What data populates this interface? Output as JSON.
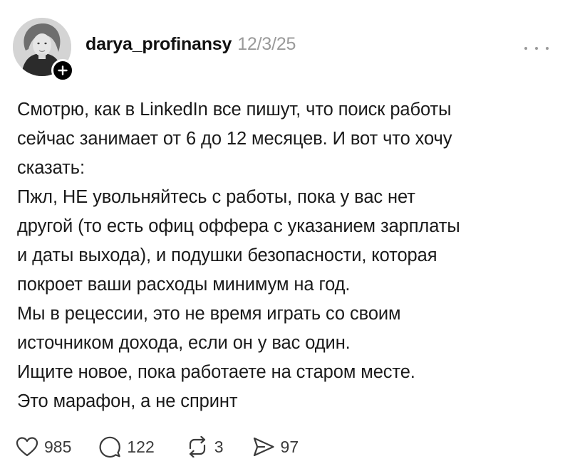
{
  "post": {
    "username": "darya_profinansy",
    "timestamp": "12/3/25",
    "more_icon": "more-dots-icon",
    "avatar_alt": "profile-photo",
    "follow_icon": "plus-icon",
    "lines": [
      "Смотрю, как в LinkedIn все пишут, что поиск работы",
      "сейчас занимает от 6 до 12 месяцев. И вот что хочу",
      "сказать:",
      "Пжл, НЕ увольняйтесь с работы, пока у вас нет",
      "другой (то есть офиц оффера с указанием зарплаты",
      "и даты выхода), и подушки безопасности, которая",
      "покроет ваши расходы минимум на год.",
      "Мы в рецессии, это не время играть со своим",
      "источником дохода, если он у вас один.",
      "Ищите новое, пока работаете на старом месте.",
      "Это марафон, а не спринт"
    ]
  },
  "actions": {
    "likes": {
      "icon": "heart-icon",
      "count": "985"
    },
    "replies": {
      "icon": "speech-bubble-icon",
      "count": "122"
    },
    "reposts": {
      "icon": "repost-icon",
      "count": "3"
    },
    "shares": {
      "icon": "send-icon",
      "count": "97"
    }
  },
  "colors": {
    "text": "#1a1a1a",
    "muted": "#9a9a9a",
    "background": "#ffffff"
  }
}
